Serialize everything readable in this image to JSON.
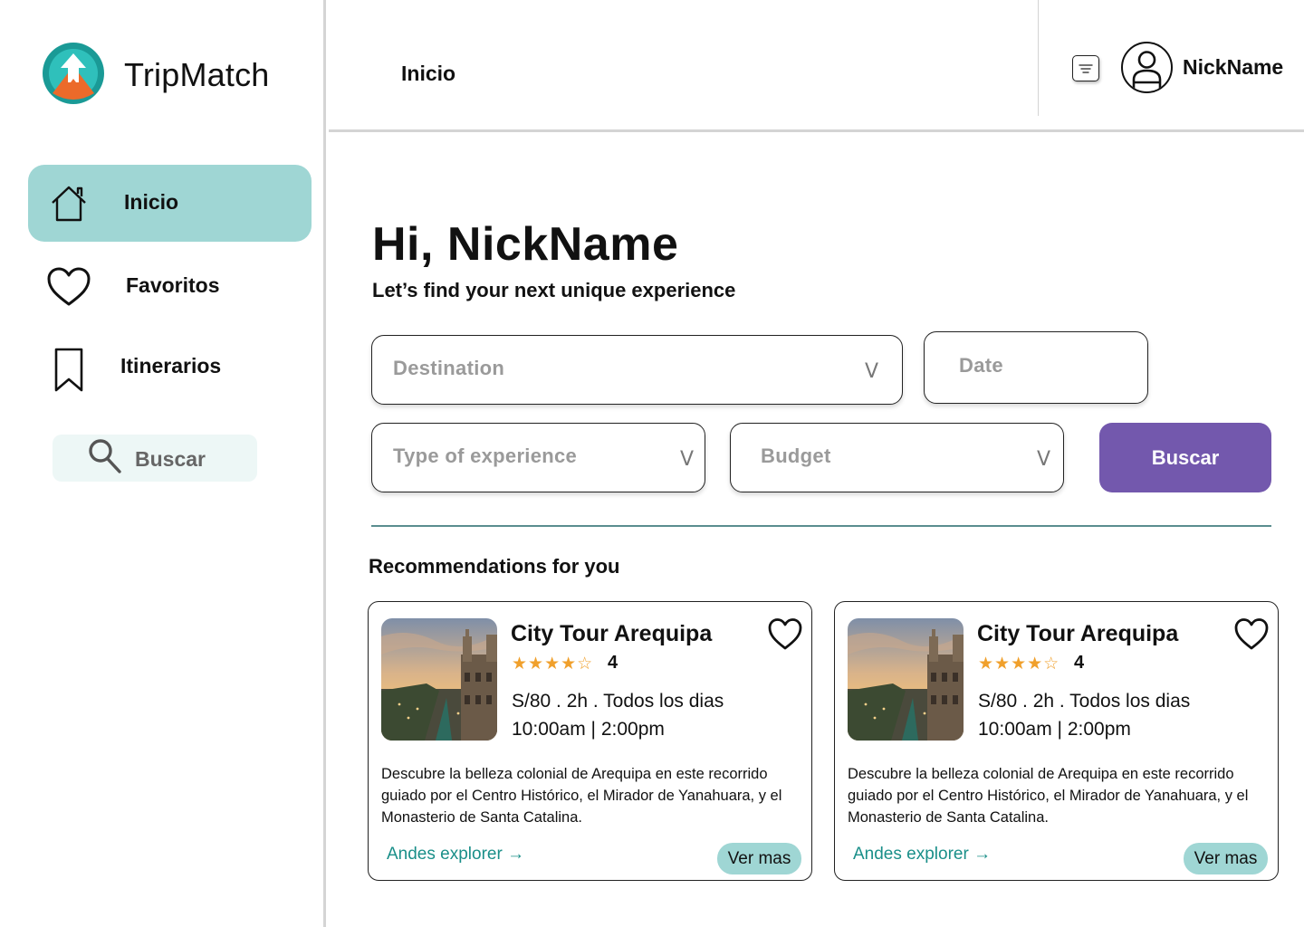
{
  "brand": {
    "name": "TripMatch",
    "icon": "tripmatch-logo-icon"
  },
  "sidebar": {
    "items": [
      {
        "label": "Inicio",
        "icon": "home-icon",
        "active": true
      },
      {
        "label": "Favoritos",
        "icon": "heart-icon",
        "active": false
      },
      {
        "label": "Itinerarios",
        "icon": "bookmark-icon",
        "active": false
      }
    ],
    "search": {
      "label": "Buscar",
      "icon": "search-icon"
    }
  },
  "header": {
    "title": "Inicio",
    "filter_icon": "filter-icon",
    "user": {
      "name": "NickName",
      "icon": "user-icon"
    }
  },
  "main": {
    "greeting": "Hi, NickName",
    "subtitle": "Let’s find your next unique experience",
    "fields": {
      "destination": "Destination",
      "date": "Date",
      "type": "Type of experience",
      "budget": "Budget",
      "chevron": "V"
    },
    "search_button": "Buscar",
    "recommendations_title": "Recommendations for you",
    "cards": [
      {
        "title": "City Tour Arequipa",
        "stars": "★★★★☆",
        "rating": "4",
        "meta_line1": "S/80 . 2h . Todos los dias",
        "meta_line2": "10:00am | 2:00pm",
        "description": "Descubre la belleza colonial de Arequipa en este recorrido guiado por el Centro Histórico, el Mirador de Yanahuara, y el Monasterio de Santa Catalina.",
        "provider": "Andes explorer →",
        "more_label": "Ver mas"
      },
      {
        "title": "City Tour Arequipa",
        "stars": "★★★★☆",
        "rating": "4",
        "meta_line1": "S/80 . 2h . Todos los dias",
        "meta_line2": "10:00am | 2:00pm",
        "description": "Descubre la belleza colonial de Arequipa en este recorrido guiado por el Centro Histórico, el Mirador de Yanahuara, y el Monasterio de Santa Catalina.",
        "provider": "Andes explorer →",
        "more_label": "Ver mas"
      }
    ]
  },
  "colors": {
    "accent_teal": "#9fd6d4",
    "primary_purple": "#7358ad",
    "star_orange": "#f0a02c",
    "link_teal": "#1a8f89",
    "search_bg": "#edf7f6"
  }
}
